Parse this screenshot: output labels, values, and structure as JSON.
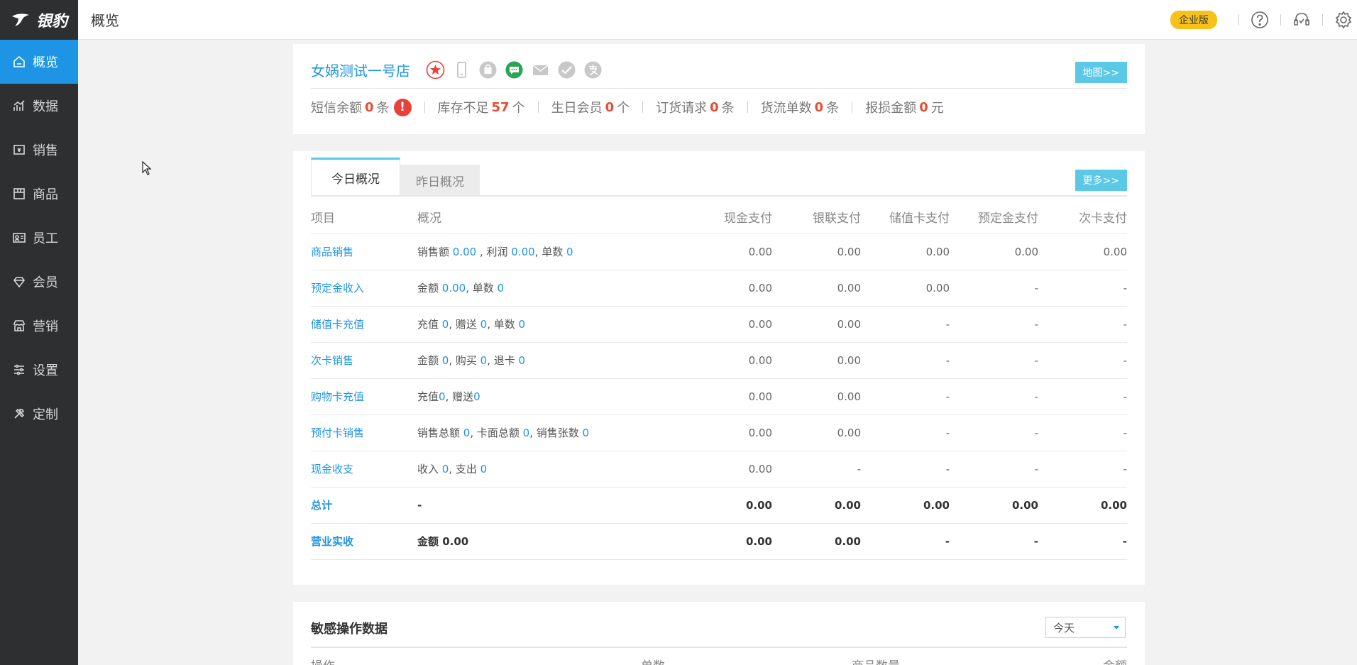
{
  "logo": {
    "text": "银豹"
  },
  "sidebar": {
    "items": [
      {
        "label": "概览",
        "icon": "home-icon",
        "active": true
      },
      {
        "label": "数据",
        "icon": "chart-icon"
      },
      {
        "label": "销售",
        "icon": "cash-register-icon"
      },
      {
        "label": "商品",
        "icon": "box-icon"
      },
      {
        "label": "员工",
        "icon": "id-card-icon"
      },
      {
        "label": "会员",
        "icon": "diamond-icon"
      },
      {
        "label": "营销",
        "icon": "store-icon"
      },
      {
        "label": "设置",
        "icon": "sliders-icon"
      },
      {
        "label": "定制",
        "icon": "tools-icon"
      }
    ]
  },
  "header": {
    "title": "概览",
    "badge": "企业版"
  },
  "store": {
    "name": "女娲测试一号店",
    "map_button": "地图>>",
    "stats": {
      "sms_label": "短信余额",
      "sms_value": "0",
      "sms_unit": "条",
      "stock_label": "库存不足",
      "stock_value": "57",
      "stock_unit": "个",
      "birthday_label": "生日会员",
      "birthday_value": "0",
      "birthday_unit": "个",
      "order_label": "订货请求",
      "order_value": "0",
      "order_unit": "条",
      "flow_label": "货流单数",
      "flow_value": "0",
      "flow_unit": "条",
      "loss_label": "报损金额",
      "loss_value": "0",
      "loss_unit": "元"
    },
    "alert": "!"
  },
  "overview": {
    "tabs": {
      "today": "今日概况",
      "yesterday": "昨日概况"
    },
    "more_button": "更多>>",
    "columns": {
      "item": "项目",
      "desc": "概况",
      "cash": "现金支付",
      "unionpay": "银联支付",
      "stored": "储值卡支付",
      "deposit": "预定金支付",
      "times": "次卡支付"
    },
    "rows": {
      "goods": {
        "item": "商品销售",
        "d1": "销售额 ",
        "v1": "0.00",
        "d2": " , 利润 ",
        "v2": "0.00",
        "d3": ", 单数 ",
        "v3": "0",
        "cash": "0.00",
        "unionpay": "0.00",
        "stored": "0.00",
        "deposit": "0.00",
        "times": "0.00"
      },
      "deposit_income": {
        "item": "预定金收入",
        "d1": "金额 ",
        "v1": "0.00",
        "d2": ", 单数 ",
        "v2": "0",
        "cash": "0.00",
        "unionpay": "0.00",
        "stored": "0.00",
        "deposit": "-",
        "times": "-"
      },
      "stored_recharge": {
        "item": "储值卡充值",
        "d1": "充值 ",
        "v1": "0",
        "d2": ", 赠送 ",
        "v2": "0",
        "d3": ", 单数 ",
        "v3": "0",
        "cash": "0.00",
        "unionpay": "0.00",
        "stored": "-",
        "deposit": "-",
        "times": "-"
      },
      "times_card": {
        "item": "次卡销售",
        "d1": "金额 ",
        "v1": "0",
        "d2": ", 购买 ",
        "v2": "0",
        "d3": ", 退卡 ",
        "v3": "0",
        "cash": "0.00",
        "unionpay": "0.00",
        "stored": "-",
        "deposit": "-",
        "times": "-"
      },
      "shopping_card": {
        "item": "购物卡充值",
        "d1": "充值",
        "v1": "0",
        "d2": ", 赠送",
        "v2": "0",
        "cash": "0.00",
        "unionpay": "0.00",
        "stored": "-",
        "deposit": "-",
        "times": "-"
      },
      "prepaid_card": {
        "item": "预付卡销售",
        "d1": "销售总额 ",
        "v1": "0",
        "d2": ", 卡面总额 ",
        "v2": "0",
        "d3": ", 销售张数 ",
        "v3": "0",
        "cash": "0.00",
        "unionpay": "0.00",
        "stored": "-",
        "deposit": "-",
        "times": "-"
      },
      "cash_flow": {
        "item": "现金收支",
        "d1": "收入 ",
        "v1": "0",
        "d2": ", 支出 ",
        "v2": "0",
        "cash": "0.00",
        "unionpay": "-",
        "stored": "-",
        "deposit": "-",
        "times": "-"
      },
      "total": {
        "item": "总计",
        "desc": "-",
        "cash": "0.00",
        "unionpay": "0.00",
        "stored": "0.00",
        "deposit": "0.00",
        "times": "0.00"
      },
      "revenue": {
        "item": "营业实收",
        "desc": "金额 0.00",
        "cash": "0.00",
        "unionpay": "0.00",
        "stored": "-",
        "deposit": "-",
        "times": "-"
      }
    }
  },
  "sensitive": {
    "title": "敏感操作数据",
    "period": "今天",
    "columns": {
      "op": "操作",
      "count": "单数",
      "qty": "商品数量",
      "amount": "金额"
    }
  },
  "colors": {
    "accent": "#1e95e4",
    "sidebar_bg": "#2d2f30",
    "button": "#5bc8e6",
    "highlight": "#e94c33",
    "badge": "#f7c11a"
  }
}
